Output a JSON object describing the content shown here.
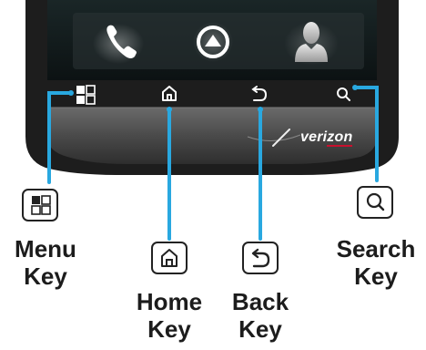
{
  "device": {
    "brand_logo": "verizon",
    "colors": {
      "callout_line": "#29a8e0",
      "bezel": "#1d1d1d",
      "chin": "#4a4a4a",
      "screen": "#101a1b"
    },
    "dock_icons": [
      "phone-icon",
      "app-launcher-icon",
      "contacts-icon"
    ],
    "soft_key_icons": [
      "menu-icon",
      "home-icon",
      "back-icon",
      "search-icon"
    ]
  },
  "keys": [
    {
      "id": "menu",
      "icon": "menu-icon",
      "line1": "Menu",
      "line2": "Key"
    },
    {
      "id": "home",
      "icon": "home-icon",
      "line1": "Home",
      "line2": "Key"
    },
    {
      "id": "back",
      "icon": "back-icon",
      "line1": "Back",
      "line2": "Key"
    },
    {
      "id": "search",
      "icon": "search-icon",
      "line1": "Search",
      "line2": "Key"
    }
  ]
}
